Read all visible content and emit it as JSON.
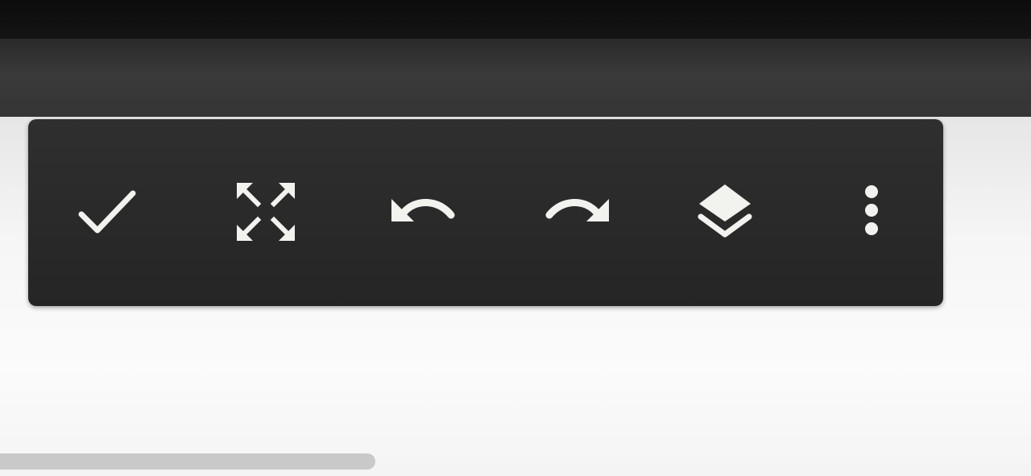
{
  "toolbar": {
    "buttons": [
      {
        "id": "confirm",
        "icon": "checkmark-icon"
      },
      {
        "id": "fullscreen",
        "icon": "expand-arrows-icon"
      },
      {
        "id": "undo",
        "icon": "undo-icon"
      },
      {
        "id": "redo",
        "icon": "redo-icon"
      },
      {
        "id": "layers",
        "icon": "layers-icon"
      },
      {
        "id": "more",
        "icon": "more-vertical-icon"
      }
    ],
    "icon_color": "#f2f2ee",
    "background_color": "#2a2a2a"
  },
  "canvas": {
    "background_color": "#f5f5f5"
  },
  "scrollbar": {
    "color": "#c9c9c9"
  }
}
